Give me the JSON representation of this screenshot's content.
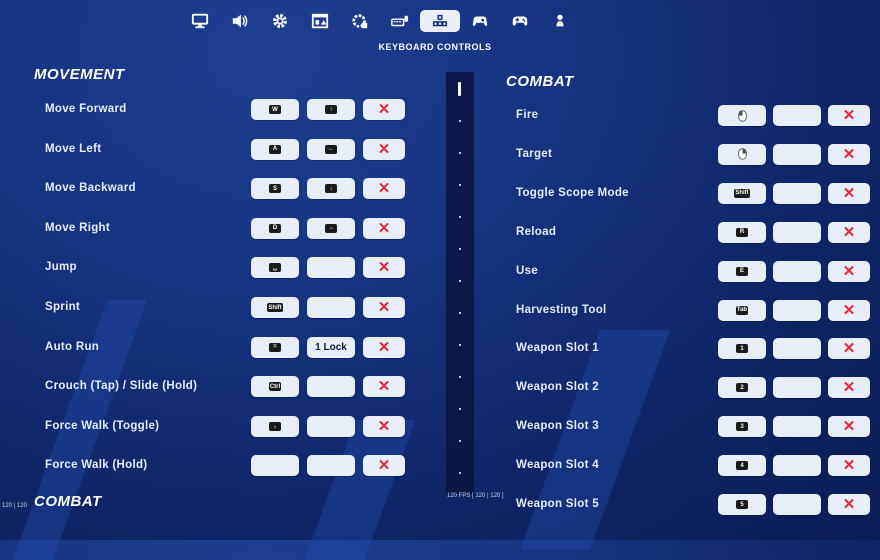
{
  "header": {
    "title": "KEYBOARD CONTROLS",
    "tabs": [
      {
        "icon": "monitor-icon"
      },
      {
        "icon": "speaker-icon"
      },
      {
        "icon": "gear-icon"
      },
      {
        "icon": "window-icon"
      },
      {
        "icon": "accessibility-icon"
      },
      {
        "icon": "keyboard-mouse-icon"
      },
      {
        "icon": "keyboard-controls-icon",
        "active": true
      },
      {
        "icon": "controller-settings-icon"
      },
      {
        "icon": "gamepad-icon"
      },
      {
        "icon": "person-icon"
      }
    ]
  },
  "movement": {
    "title": "MOVEMENT",
    "rows": [
      {
        "label": "Move Forward",
        "primary": "W",
        "secondary": "↑",
        "clear": "✕"
      },
      {
        "label": "Move Left",
        "primary": "A",
        "secondary": "←",
        "clear": "✕"
      },
      {
        "label": "Move Backward",
        "primary": "S",
        "secondary": "↓",
        "clear": "✕"
      },
      {
        "label": "Move Right",
        "primary": "D",
        "secondary": "→",
        "clear": "✕"
      },
      {
        "label": "Jump",
        "primary": "␣",
        "secondary": "",
        "clear": "✕"
      },
      {
        "label": "Sprint",
        "primary": "Shift",
        "secondary": "",
        "clear": "✕"
      },
      {
        "label": "Auto Run",
        "primary": "=",
        "secondary": "1 Lock",
        "clear": "✕"
      },
      {
        "label": "Crouch (Tap) / Slide (Hold)",
        "primary": "Ctrl",
        "secondary": "",
        "clear": "✕"
      },
      {
        "label": "Force Walk (Toggle)",
        "primary": ",",
        "secondary": "",
        "clear": "✕"
      },
      {
        "label": "Force Walk (Hold)",
        "primary": "",
        "secondary": "",
        "clear": "✕"
      }
    ],
    "next_section": "COMBAT"
  },
  "combat": {
    "title": "COMBAT",
    "rows": [
      {
        "label": "Fire",
        "primary_icon": "left-mouse-icon",
        "secondary": "",
        "clear": "✕"
      },
      {
        "label": "Target",
        "primary_icon": "right-mouse-icon",
        "secondary": "",
        "clear": "✕"
      },
      {
        "label": "Toggle Scope Mode",
        "primary": "Shift",
        "secondary": "",
        "clear": "✕"
      },
      {
        "label": "Reload",
        "primary": "R",
        "secondary": "",
        "clear": "✕"
      },
      {
        "label": "Use",
        "primary": "E",
        "secondary": "",
        "clear": "✕"
      },
      {
        "label": "Harvesting Tool",
        "primary": "Tab",
        "secondary": "",
        "clear": "✕"
      },
      {
        "label": "Weapon Slot 1",
        "primary": "1",
        "secondary": "",
        "clear": "✕"
      },
      {
        "label": "Weapon Slot 2",
        "primary": "2",
        "secondary": "",
        "clear": "✕"
      },
      {
        "label": "Weapon Slot 3",
        "primary": "3",
        "secondary": "",
        "clear": "✕"
      },
      {
        "label": "Weapon Slot 4",
        "primary": "4",
        "secondary": "",
        "clear": "✕"
      },
      {
        "label": "Weapon Slot 5",
        "primary": "5",
        "secondary": "",
        "clear": "✕"
      }
    ]
  },
  "fps": {
    "left": "120 | 120",
    "center": "120 FPS [ 120 | 120 ]"
  }
}
